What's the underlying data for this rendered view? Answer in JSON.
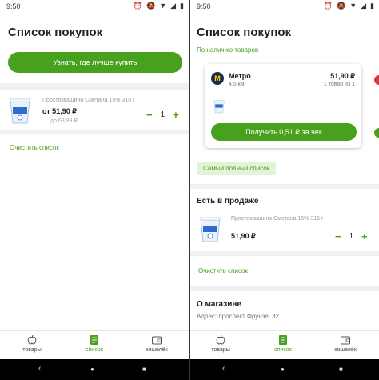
{
  "status": {
    "time": "9:50"
  },
  "left": {
    "title": "Список покупок",
    "cta_label": "Узнать, где лучше купить",
    "product": {
      "name": "Простоквашино Сметана 15% 315 г",
      "price": "от 51,90 ₽",
      "old_price": "до 63,99 ₽",
      "qty": "1"
    },
    "clear_label": "Очистить список"
  },
  "right": {
    "title": "Список покупок",
    "availability_link": "По наличию товаров",
    "store": {
      "logo_letter": "M",
      "name": "Метро",
      "distance": "4,5 км",
      "price": "51,90 ₽",
      "count": "1 товар из 1",
      "button_label": "Получить 0,51 ₽ за чек"
    },
    "full_list_label": "Самый полный список",
    "in_stock_title": "Есть в продаже",
    "product": {
      "name": "Простоквашино Сметана 15% 315 г",
      "price": "51,90 ₽",
      "qty": "1"
    },
    "clear_label": "Очистить список",
    "about_title": "О магазине",
    "address": "Адрес: проспект Фрунзе, 32"
  },
  "nav": {
    "items": [
      {
        "label": "товары",
        "icon": "apple-icon"
      },
      {
        "label": "список",
        "icon": "list-icon",
        "active": true
      },
      {
        "label": "кошелёк",
        "icon": "wallet-icon"
      }
    ]
  },
  "system_nav": {
    "back": "‹",
    "home": "●",
    "recents": "■"
  },
  "colors": {
    "accent": "#47a11d",
    "chip_bg": "#e3f3d8",
    "metro_blue": "#1d2b52",
    "metro_yellow": "#ffd200"
  }
}
